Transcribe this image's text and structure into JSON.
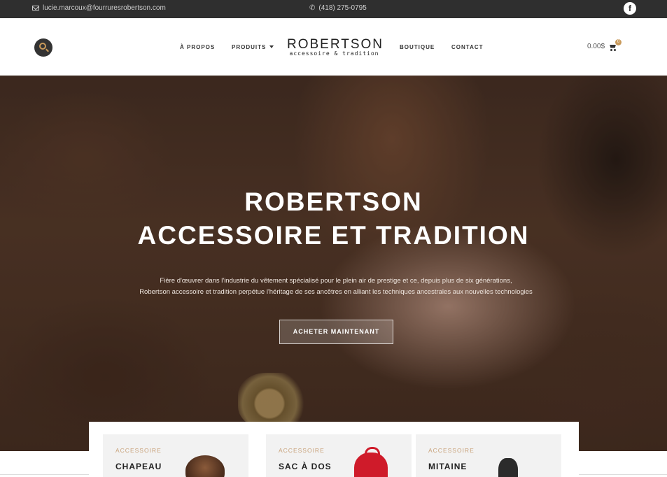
{
  "topbar": {
    "email": "lucie.marcoux@fourruresrobertson.com",
    "phone": "(418) 275-0795",
    "social_icon": "f",
    "icons": [
      "mail-icon",
      "phone-icon",
      "facebook-icon"
    ]
  },
  "header": {
    "nav": {
      "apropos": "À PROPOS",
      "produits": "PRODUITS",
      "boutique": "BOUTIQUE",
      "contact": "CONTACT"
    },
    "logo": {
      "name": "ROBERTSON",
      "tagline": "accessoire & tradition"
    },
    "cart": {
      "total": "0.00$",
      "count": "0"
    },
    "icons": [
      "search-icon",
      "cart-icon",
      "chevron-down-icon"
    ]
  },
  "hero": {
    "title_line1": "ROBERTSON",
    "title_line2": "ACCESSOIRE ET TRADITION",
    "description_line1": "Fière d'œuvrer dans l'industrie du vêtement spécialisé pour le plein air de prestige et ce, depuis plus de six générations,",
    "description_line2": "Robertson accessoire et tradition perpétue l'héritage de ses ancêtres en alliant les techniques ancestrales aux nouvelles technologies",
    "cta_label": "ACHETER MAINTENANT"
  },
  "categories": [
    {
      "category": "ACCESSOIRE",
      "title": "CHAPEAU"
    },
    {
      "category": "ACCESSOIRE",
      "title": "SAC À DOS"
    },
    {
      "category": "ACCESSOIRE",
      "title": "MITAINE"
    }
  ],
  "colors": {
    "accent": "#c99a5b",
    "topbar_bg": "#2f2f2f",
    "card_bg": "#f2f2f2",
    "category_text": "#c8a27a"
  }
}
